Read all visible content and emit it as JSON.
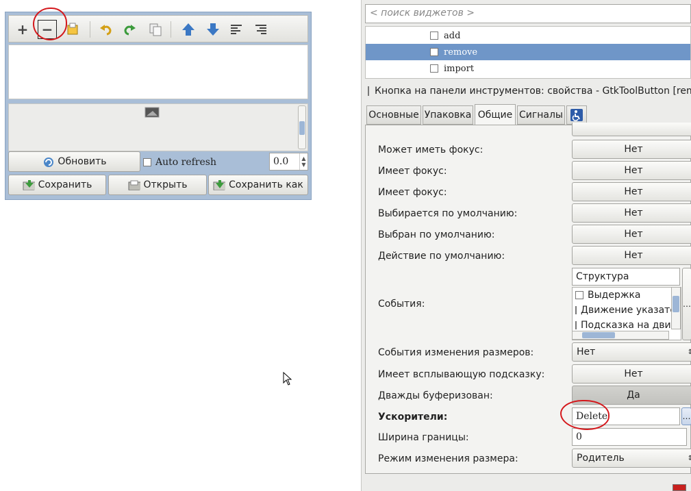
{
  "design_window": {
    "toolbar": {
      "add": "+",
      "remove": "−"
    },
    "buttons": {
      "refresh": "Обновить",
      "auto_refresh": "Auto refresh",
      "refresh_value": "0.0",
      "save": "Сохранить",
      "open": "Открыть",
      "save_as": "Сохранить как"
    }
  },
  "inspector": {
    "search_placeholder": "< поиск виджетов >",
    "widgets": [
      {
        "name": "add",
        "selected": false
      },
      {
        "name": "remove",
        "selected": true
      },
      {
        "name": "import",
        "selected": false
      }
    ],
    "properties_title": "Кнопка на панели инструментов: свойства - GtkToolButton [remove]",
    "tabs": [
      {
        "label": "Основные",
        "active": false
      },
      {
        "label": "Упаковка",
        "active": false
      },
      {
        "label": "Общие",
        "active": true
      },
      {
        "label": "Сигналы",
        "active": false
      }
    ],
    "tab_accessibility_icon": "accessibility-icon",
    "properties": {
      "can_focus": {
        "label": "Может иметь фокус:",
        "value": "Нет"
      },
      "has_focus": {
        "label": "Имеет фокус:",
        "value": "Нет"
      },
      "is_focus": {
        "label": "Имеет фокус:",
        "value": "Нет"
      },
      "can_default": {
        "label": "Выбирается по умолчанию:",
        "value": "Нет"
      },
      "has_default": {
        "label": "Выбран по умолчанию:",
        "value": "Нет"
      },
      "receives_default": {
        "label": "Действие по умолчанию:",
        "value": "Нет"
      },
      "events": {
        "label": "События:",
        "field": "Структура",
        "items": [
          "Выдержка",
          "Движение указателя",
          "Подсказка на движение"
        ]
      },
      "extension_events": {
        "label": "События изменения размеров:",
        "value": "Нет"
      },
      "has_tooltip": {
        "label": "Имеет всплывающую подсказку:",
        "value": "Нет"
      },
      "double_buffered": {
        "label": "Дважды буферизован:",
        "value": "Да"
      },
      "accelerators": {
        "label": "Ускорители:",
        "value": "Delete"
      },
      "border_width": {
        "label": "Ширина границы:",
        "value": "0"
      },
      "resize_mode": {
        "label": "Режим изменения размера:",
        "value": "Родитель"
      }
    }
  },
  "colors": {
    "selection": "#6f96c8",
    "annotation": "#d4181c",
    "design_frame": "#a9bed7"
  }
}
